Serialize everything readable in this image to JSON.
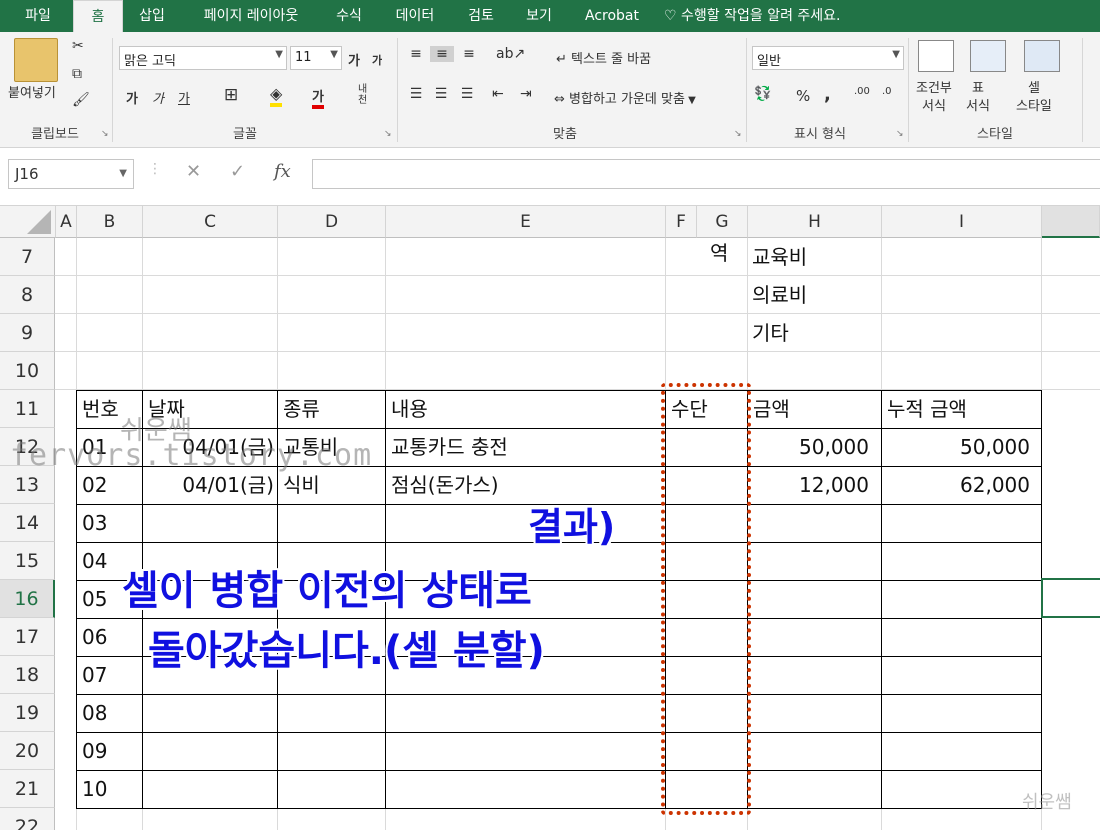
{
  "menubar": {
    "tabs": [
      "파일",
      "홈",
      "삽입",
      "페이지 레이아웃",
      "수식",
      "데이터",
      "검토",
      "보기",
      "Acrobat"
    ],
    "active_tab": "홈",
    "tell_me": "수행할 작업을 알려 주세요."
  },
  "ribbon": {
    "clipboard": {
      "paste_label": "붙여넣기",
      "group_label": "클립보드"
    },
    "font": {
      "name": "맑은 고딕",
      "size": "11",
      "bold": "가",
      "italic": "가",
      "underline": "가",
      "grow": "가",
      "shrink": "가",
      "font_color_glyph": "가",
      "phonetic": "내천",
      "group_label": "글꼴"
    },
    "alignment": {
      "wrap_text": "텍스트 줄 바꿈",
      "merge_center": "병합하고 가운데 맞춤",
      "group_label": "맞춤"
    },
    "number": {
      "format": "일반",
      "percent": "%",
      "comma": ",",
      "group_label": "표시 형식"
    },
    "styles": {
      "conditional": [
        "조건부",
        "서식"
      ],
      "table": [
        "표",
        "서식"
      ],
      "cell": [
        "셀",
        "스타일"
      ],
      "group_label": "스타일"
    }
  },
  "formula_bar": {
    "name_box": "J16",
    "cancel": "✕",
    "enter": "✓",
    "fx": "fx",
    "formula": ""
  },
  "columns": [
    "A",
    "B",
    "C",
    "D",
    "E",
    "F",
    "G",
    "H",
    "I"
  ],
  "rows": [
    "7",
    "8",
    "9",
    "10",
    "11",
    "12",
    "13",
    "14",
    "15",
    "16",
    "17",
    "18",
    "19",
    "20",
    "21",
    "22"
  ],
  "selected_row": "16",
  "cells": {
    "G7": "역",
    "H7": "교육비",
    "H8": "의료비",
    "H9": "기타",
    "headers": [
      "번호",
      "날짜",
      "종류",
      "내용",
      "수단",
      "금액",
      "누적 금액"
    ],
    "r12": {
      "no": "01",
      "date": "04/01(금)",
      "type": "교통비",
      "desc": "교통카드 충전",
      "amount": "50,000",
      "cum": "50,000"
    },
    "r13": {
      "no": "02",
      "date": "04/01(금)",
      "type": "식비",
      "desc": "점심(돈가스)",
      "amount": "12,000",
      "cum": "62,000"
    },
    "nums": [
      "03",
      "04",
      "05",
      "06",
      "07",
      "08",
      "09",
      "10"
    ]
  },
  "annotation": {
    "line1": "결과)",
    "line2": "셀이 병합 이전의 상태로",
    "line3": "돌아갔습니다.(셀 분할)",
    "color": "#1010e0",
    "highlight_color": "#cc3300"
  },
  "watermark": {
    "korean": "쉬운쌤",
    "site": "fervors.tistory.com",
    "corner": "쉬운쌤"
  }
}
